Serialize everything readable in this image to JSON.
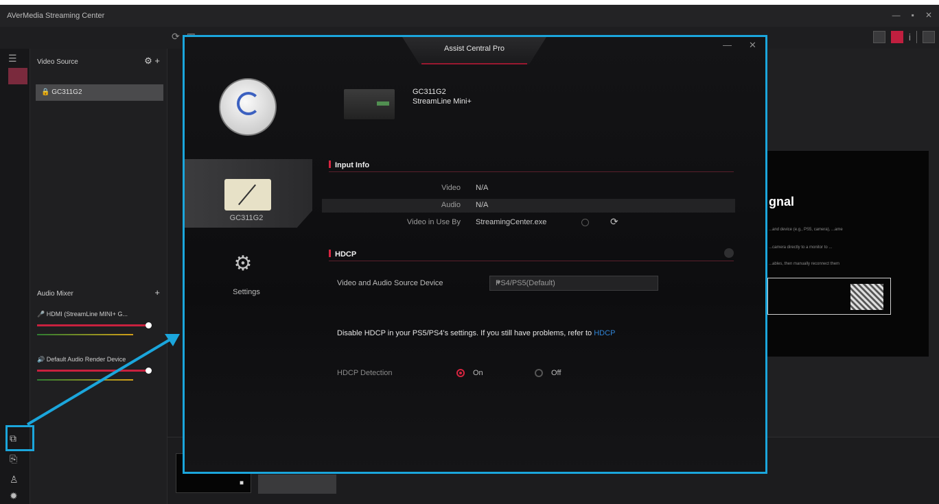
{
  "app": {
    "title": "AVerMedia Streaming Center",
    "window_controls": [
      "—",
      "▪",
      "✕"
    ]
  },
  "sidebar": {
    "video_source_title": "Video Source",
    "video_source_item": "GC311G2",
    "audio_mixer_title": "Audio Mixer",
    "audio_items": [
      {
        "label": "HDMI (StreamLine MINI+ G..."
      },
      {
        "label": "Default Audio Render Device"
      }
    ]
  },
  "preview": {
    "signal_text": "gnal",
    "line1": "...and device (e.g., PS5, camera), ...ame",
    "line2": "...camera directly to a monitor to ...",
    "line3": "...ables, then manually reconnect them"
  },
  "dialog": {
    "title": "Assist Central Pro",
    "device": {
      "line1": "GC311G2",
      "line2": "StreamLine Mini+"
    },
    "tabs": [
      {
        "label": "GC311G2"
      },
      {
        "label": "Settings"
      }
    ],
    "input_info": {
      "heading": "Input Info",
      "video_label": "Video",
      "video_value": "N/A",
      "audio_label": "Audio",
      "audio_value": "N/A",
      "in_use_label": "Video in Use By",
      "in_use_value": "StreamingCenter.exe"
    },
    "hdcp": {
      "heading": "HDCP",
      "source_label": "Video and Audio Source Device",
      "source_value": "PS4/PS5(Default)",
      "note_text": "Disable HDCP in your PS5/PS4's settings. If you still have problems, refer to ",
      "note_link": "HDCP",
      "detection_label": "HDCP Detection",
      "on_label": "On",
      "off_label": "Off",
      "detection_value": "On"
    }
  },
  "accent": {
    "highlight": "#1ba6dc",
    "brand": "#c8213e"
  }
}
